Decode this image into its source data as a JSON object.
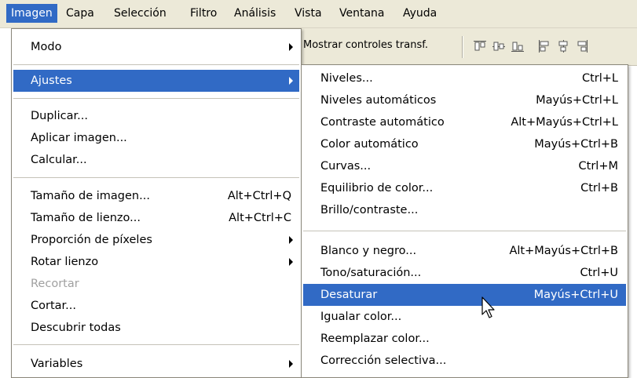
{
  "menubar": {
    "items": [
      {
        "label": "Imagen"
      },
      {
        "label": "Capa"
      },
      {
        "label": "Selección"
      },
      {
        "label": "Filtro"
      },
      {
        "label": "Análisis"
      },
      {
        "label": "Vista"
      },
      {
        "label": "Ventana"
      },
      {
        "label": "Ayuda"
      }
    ]
  },
  "toolbar": {
    "show_transform_label": "Mostrar controles transf."
  },
  "imagen_menu": {
    "items": [
      {
        "label": "Modo",
        "shortcut": ""
      },
      {
        "label": "Ajustes",
        "shortcut": ""
      },
      {
        "label": "Duplicar...",
        "shortcut": ""
      },
      {
        "label": "Aplicar imagen...",
        "shortcut": ""
      },
      {
        "label": "Calcular...",
        "shortcut": ""
      },
      {
        "label": "Tamaño de imagen...",
        "shortcut": "Alt+Ctrl+Q"
      },
      {
        "label": "Tamaño de lienzo...",
        "shortcut": "Alt+Ctrl+C"
      },
      {
        "label": "Proporción de píxeles",
        "shortcut": ""
      },
      {
        "label": "Rotar lienzo",
        "shortcut": ""
      },
      {
        "label": "Recortar",
        "shortcut": ""
      },
      {
        "label": "Cortar...",
        "shortcut": ""
      },
      {
        "label": "Descubrir todas",
        "shortcut": ""
      },
      {
        "label": "Variables",
        "shortcut": ""
      }
    ]
  },
  "ajustes_menu": {
    "items": [
      {
        "label": "Niveles...",
        "shortcut": "Ctrl+L"
      },
      {
        "label": "Niveles automáticos",
        "shortcut": "Mayús+Ctrl+L"
      },
      {
        "label": "Contraste automático",
        "shortcut": "Alt+Mayús+Ctrl+L"
      },
      {
        "label": "Color automático",
        "shortcut": "Mayús+Ctrl+B"
      },
      {
        "label": "Curvas...",
        "shortcut": "Ctrl+M"
      },
      {
        "label": "Equilibrio de color...",
        "shortcut": "Ctrl+B"
      },
      {
        "label": "Brillo/contraste...",
        "shortcut": ""
      },
      {
        "label": "Blanco y negro...",
        "shortcut": "Alt+Mayús+Ctrl+B"
      },
      {
        "label": "Tono/saturación...",
        "shortcut": "Ctrl+U"
      },
      {
        "label": "Desaturar",
        "shortcut": "Mayús+Ctrl+U"
      },
      {
        "label": "Igualar color...",
        "shortcut": ""
      },
      {
        "label": "Reemplazar color...",
        "shortcut": ""
      },
      {
        "label": "Corrección selectiva...",
        "shortcut": ""
      }
    ]
  },
  "colors": {
    "highlight": "#316ac5",
    "menubar_bg": "#ece9d8",
    "disabled_text": "#a0a0a0"
  }
}
